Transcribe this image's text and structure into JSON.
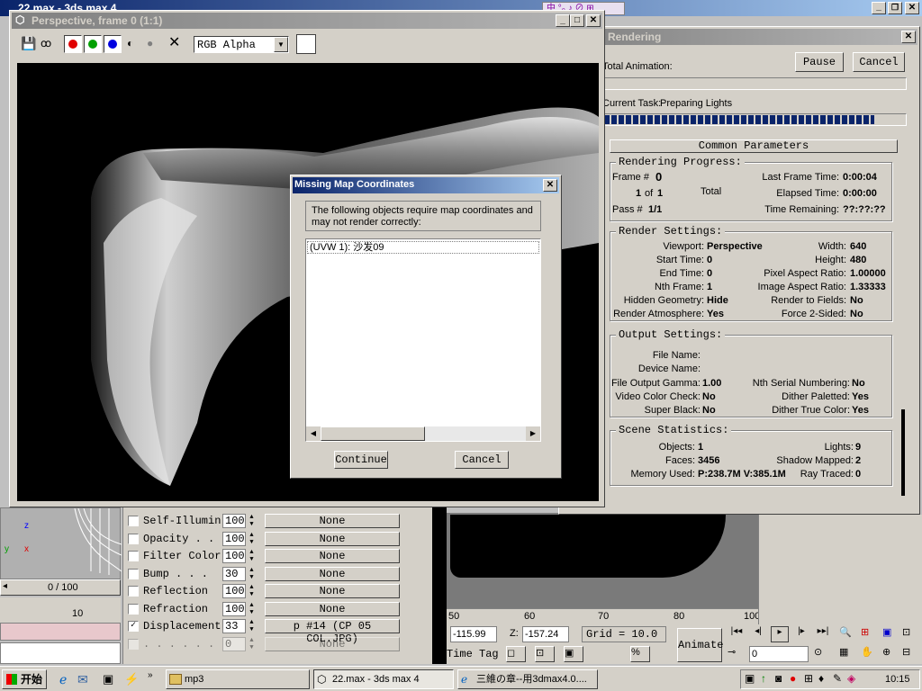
{
  "app": {
    "title": "22.max - 3ds max 4"
  },
  "render_window": {
    "title": "Perspective, frame 0 (1:1)",
    "channel": "RGB Alpha"
  },
  "missing_map": {
    "title": "Missing Map Coordinates",
    "message": "The following objects require map coordinates and may not render correctly:",
    "items": [
      "(UVW 1): 沙发09"
    ],
    "continue_label": "Continue",
    "cancel_label": "Cancel"
  },
  "rendering": {
    "title": "Rendering",
    "total_animation_label": "Total Animation:",
    "current_task_label": "Current Task:",
    "current_task_value": "Preparing Lights",
    "pause_label": "Pause",
    "cancel_label": "Cancel",
    "rollout_title": "Common Parameters",
    "progress": {
      "title": "Rendering Progress:",
      "frame_label": "Frame #",
      "frame_value": "0",
      "of_value": "1",
      "of_word": "of",
      "of_total": "1",
      "total_label": "Total",
      "pass_label": "Pass #",
      "pass_value": "1/1",
      "last_frame_label": "Last Frame Time:",
      "last_frame_value": "0:00:04",
      "elapsed_label": "Elapsed Time:",
      "elapsed_value": "0:00:00",
      "remaining_label": "Time Remaining:",
      "remaining_value": "??:??:??"
    },
    "settings": {
      "title": "Render Settings:",
      "viewport_label": "Viewport:",
      "viewport_value": "Perspective",
      "width_label": "Width:",
      "width_value": "640",
      "start_label": "Start Time:",
      "start_value": "0",
      "height_label": "Height:",
      "height_value": "480",
      "end_label": "End Time:",
      "end_value": "0",
      "pixel_aspect_label": "Pixel Aspect Ratio:",
      "pixel_aspect_value": "1.00000",
      "nth_label": "Nth Frame:",
      "nth_value": "1",
      "image_aspect_label": "Image Aspect Ratio:",
      "image_aspect_value": "1.33333",
      "hidden_geom_label": "Hidden Geometry:",
      "hidden_geom_value": "Hide",
      "render_fields_label": "Render to Fields:",
      "render_fields_value": "No",
      "atmosphere_label": "Render Atmosphere:",
      "atmosphere_value": "Yes",
      "force2_label": "Force 2-Sided:",
      "force2_value": "No"
    },
    "output": {
      "title": "Output Settings:",
      "file_name_label": "File Name:",
      "device_name_label": "Device Name:",
      "gamma_label": "File Output Gamma:",
      "gamma_value": "1.00",
      "serial_label": "Nth Serial Numbering:",
      "serial_value": "No",
      "video_check_label": "Video Color Check:",
      "video_check_value": "No",
      "dither_pal_label": "Dither Paletted:",
      "dither_pal_value": "Yes",
      "super_black_label": "Super Black:",
      "super_black_value": "No",
      "dither_true_label": "Dither True Color:",
      "dither_true_value": "Yes"
    },
    "scene": {
      "title": "Scene Statistics:",
      "objects_label": "Objects:",
      "objects_value": "1",
      "lights_label": "Lights:",
      "lights_value": "9",
      "faces_label": "Faces:",
      "faces_value": "3456",
      "shadow_label": "Shadow Mapped:",
      "shadow_value": "2",
      "memory_label": "Memory Used:",
      "memory_value": "P:238.7M V:385.1M",
      "ray_label": "Ray Traced:",
      "ray_value": "0"
    }
  },
  "maps": {
    "rows": [
      {
        "name": "Self-Illumin",
        "amount": "100",
        "map": "None",
        "checked": ""
      },
      {
        "name": "Opacity . .",
        "amount": "100",
        "map": "None",
        "checked": ""
      },
      {
        "name": "Filter Color",
        "amount": "100",
        "map": "None",
        "checked": ""
      },
      {
        "name": "Bump . . .",
        "amount": "30",
        "map": "None",
        "checked": ""
      },
      {
        "name": "Reflection",
        "amount": "100",
        "map": "None",
        "checked": ""
      },
      {
        "name": "Refraction",
        "amount": "100",
        "map": "None",
        "checked": ""
      },
      {
        "name": "Displacement",
        "amount": "33",
        "map": "p #14 (CP 05 COL.JPG)",
        "checked": "✓"
      },
      {
        "name": ". . . . . . .",
        "amount": "0",
        "map": "None",
        "checked": ""
      }
    ]
  },
  "timeline": {
    "frame": "0 / 100",
    "tick_10": "10",
    "tick_50": "50",
    "tick_60": "60",
    "tick_70": "70",
    "tick_80": "80",
    "tick_90": "90",
    "tick_100": "100"
  },
  "status": {
    "x_value": "-115.99",
    "z_label": "Z:",
    "z_value": "-157.24",
    "grid": "Grid = 10.0",
    "time_tag": "Time Tag",
    "animate": "Animate",
    "frame_field": "0"
  },
  "taskbar": {
    "start": "开始",
    "items": [
      "mp3",
      "22.max - 3ds max 4",
      "三維の章--用3dmax4.0...."
    ],
    "clock": "10:15"
  }
}
